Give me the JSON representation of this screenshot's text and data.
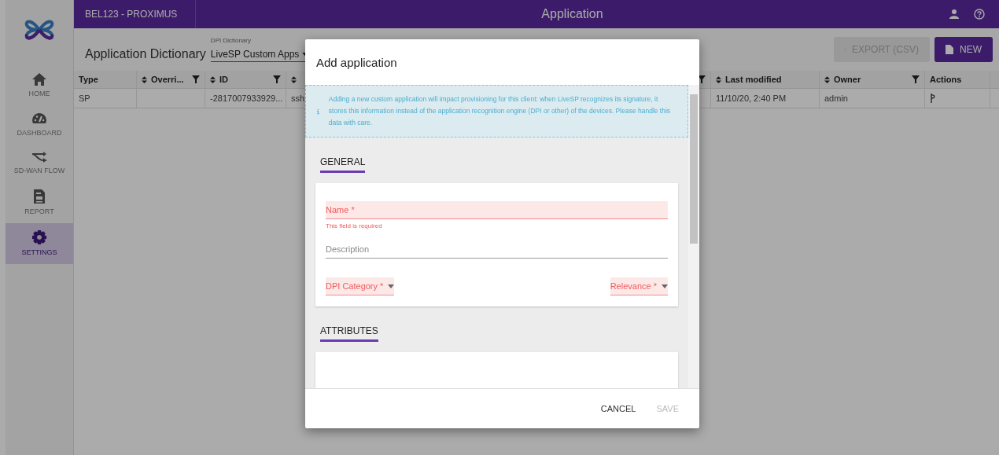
{
  "top_bar": {
    "client": "BEL123 - PROXIMUS",
    "title": "Application"
  },
  "sidebar": {
    "items": [
      {
        "label": "HOME",
        "selected": false
      },
      {
        "label": "DASHBOARD",
        "selected": false
      },
      {
        "label": "SD-WAN FLOW",
        "selected": false
      },
      {
        "label": "REPORT",
        "selected": false
      },
      {
        "label": "SETTINGS",
        "selected": true
      }
    ]
  },
  "page": {
    "title": "Application Dictionary",
    "dictionary": {
      "label": "DPI Dictionary",
      "value": "LiveSP Custom Apps"
    },
    "buttons": [
      {
        "kind": "export",
        "label": "EXPORT (CSV)",
        "disabled": true
      },
      {
        "kind": "new",
        "label": "NEW",
        "disabled": false
      }
    ]
  },
  "table": {
    "columns": [
      {
        "kind": "text",
        "label": "Type",
        "sortable": false,
        "filterable": false
      },
      {
        "kind": "text",
        "label": "Overri...",
        "sortable": true,
        "filterable": true
      },
      {
        "kind": "text",
        "label": "ID",
        "sortable": true,
        "filterable": true
      },
      {
        "kind": "text",
        "sortable": true,
        "filterable": true
      },
      {
        "kind": "text",
        "label": "Last modified",
        "sortable": true,
        "filterable": false
      },
      {
        "kind": "text",
        "label": "Owner",
        "sortable": true,
        "filterable": true
      },
      {
        "kind": "actions",
        "label": "Actions",
        "sortable": false,
        "filterable": false
      }
    ],
    "rows": [
      {
        "cells": [
          "SP",
          null,
          "-2817007933929...",
          "ssh",
          "11/10/20, 2:40 PM",
          "admin",
          null
        ]
      }
    ]
  },
  "modal": {
    "title": "Add application",
    "notice": "Adding a new custom application will impact provisioning for this client: when LiveSP recognizes its signature, it stores this information instead of the application recognition engine (DPI or other) of the devices. Please handle this data with care.",
    "sections": [
      {
        "title": "GENERAL",
        "fields": [
          {
            "kind": "text",
            "label": "Name *",
            "invalid": true,
            "error": "This field is required"
          },
          {
            "kind": "text",
            "label": "Description",
            "invalid": false
          },
          {
            "kind": "selects",
            "selects": [
              {
                "label": "DPI Category *",
                "invalid": true
              },
              {
                "label": "Relevance *",
                "invalid": true
              }
            ]
          }
        ]
      },
      {
        "title": "ATTRIBUTES"
      }
    ],
    "buttons": [
      {
        "label": "CANCEL",
        "disabled": false
      },
      {
        "label": "SAVE",
        "disabled": true
      }
    ]
  }
}
